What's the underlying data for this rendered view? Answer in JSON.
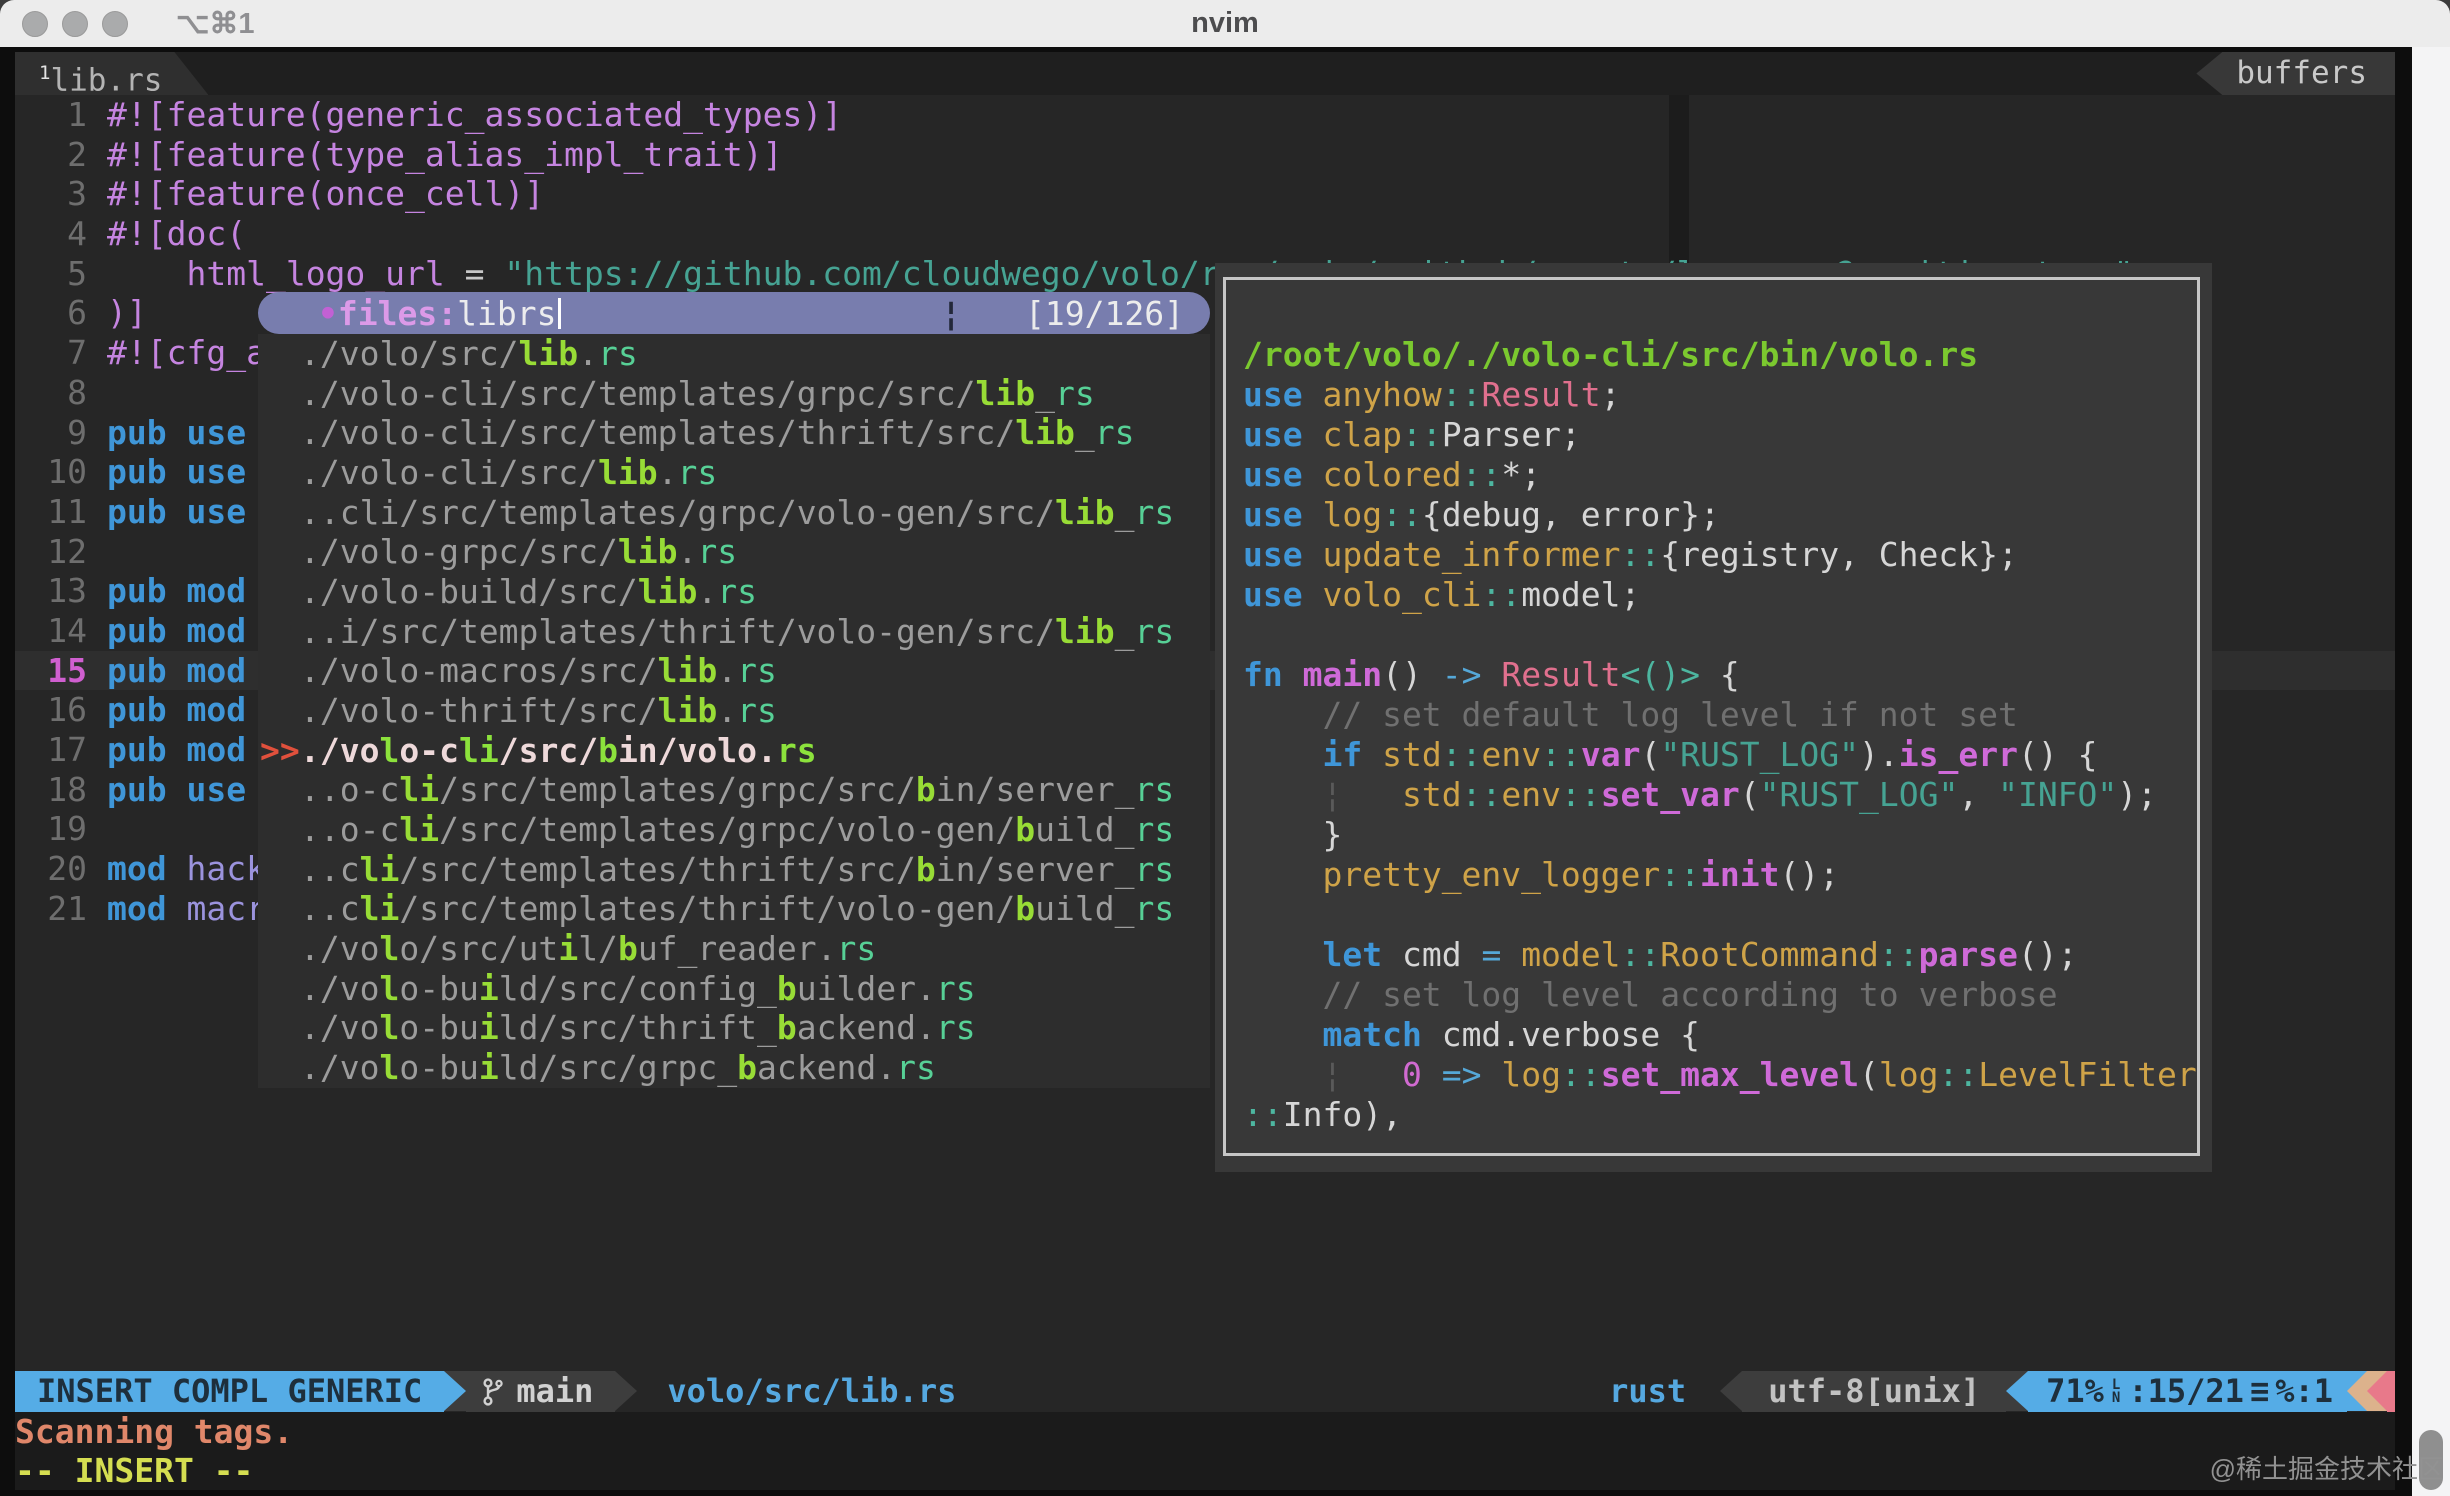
{
  "window": {
    "title": "nvim",
    "shortcut": "⌥⌘1"
  },
  "tabline": {
    "tab_index": "1",
    "tab_label": "lib.rs",
    "right_label": "buffers"
  },
  "editor": {
    "cursor_line": 15,
    "lines": [
      {
        "num": "1",
        "segs": [
          [
            "attr",
            "#![feature(generic_associated_types)]"
          ]
        ]
      },
      {
        "num": "2",
        "segs": [
          [
            "attr",
            "#![feature(type_alias_impl_trait)]"
          ]
        ]
      },
      {
        "num": "3",
        "segs": [
          [
            "attr",
            "#![feature(once_cell)]"
          ]
        ]
      },
      {
        "num": "4",
        "segs": [
          [
            "attr",
            "#![doc("
          ]
        ]
      },
      {
        "num": "5",
        "segs": [
          [
            "txt",
            "    "
          ],
          [
            "attr",
            "html_logo_url"
          ],
          [
            "txt",
            " = "
          ],
          [
            "str",
            "\"https://github.com/cloudwego/volo/raw/main/.github/assets/logo.png?sanitize=true\""
          ]
        ]
      },
      {
        "num": "6",
        "segs": [
          [
            "attr",
            ")]"
          ]
        ]
      },
      {
        "num": "7",
        "segs": [
          [
            "attr",
            "#![cfg_a"
          ]
        ]
      },
      {
        "num": "8",
        "segs": []
      },
      {
        "num": "9",
        "segs": [
          [
            "kw",
            "pub use"
          ]
        ]
      },
      {
        "num": "10",
        "segs": [
          [
            "kw",
            "pub use"
          ]
        ]
      },
      {
        "num": "11",
        "segs": [
          [
            "kw",
            "pub use"
          ]
        ]
      },
      {
        "num": "12",
        "segs": []
      },
      {
        "num": "13",
        "segs": [
          [
            "kw",
            "pub mod"
          ]
        ]
      },
      {
        "num": "14",
        "segs": [
          [
            "kw",
            "pub mod"
          ]
        ]
      },
      {
        "num": "15",
        "segs": [
          [
            "kw",
            "pub mod"
          ]
        ]
      },
      {
        "num": "16",
        "segs": [
          [
            "kw",
            "pub mod"
          ]
        ]
      },
      {
        "num": "17",
        "segs": [
          [
            "kw",
            "pub mod"
          ]
        ]
      },
      {
        "num": "18",
        "segs": [
          [
            "kw",
            "pub use"
          ]
        ]
      },
      {
        "num": "19",
        "segs": []
      },
      {
        "num": "20",
        "segs": [
          [
            "kw",
            "mod"
          ],
          [
            "txt",
            " "
          ],
          [
            "mod2",
            "hack"
          ]
        ]
      },
      {
        "num": "21",
        "segs": [
          [
            "kw",
            "mod"
          ],
          [
            "txt",
            " "
          ],
          [
            "mod2",
            "macr"
          ]
        ]
      }
    ]
  },
  "popup": {
    "bullet": "•",
    "mode_label": "files:",
    "query": "librs",
    "separator": "¦",
    "count": "[19/126]",
    "marker": ">>",
    "selected_index": 10,
    "items": [
      {
        "segs": [
          [
            "g",
            "./volo/src/"
          ],
          [
            "m",
            "lib"
          ],
          [
            "g",
            "."
          ],
          [
            "e",
            "rs"
          ]
        ]
      },
      {
        "segs": [
          [
            "g",
            "./volo-cli/src/templates/grpc/src/"
          ],
          [
            "m",
            "lib"
          ],
          [
            "g",
            "_"
          ],
          [
            "e",
            "rs"
          ]
        ]
      },
      {
        "segs": [
          [
            "g",
            "./volo-cli/src/templates/thrift/src/"
          ],
          [
            "m",
            "lib"
          ],
          [
            "g",
            "_"
          ],
          [
            "e",
            "rs"
          ]
        ]
      },
      {
        "segs": [
          [
            "g",
            "./volo-cli/src/"
          ],
          [
            "m",
            "lib"
          ],
          [
            "g",
            "."
          ],
          [
            "e",
            "rs"
          ]
        ]
      },
      {
        "segs": [
          [
            "g",
            "..cli/src/templates/grpc/volo-gen/src/"
          ],
          [
            "m",
            "lib"
          ],
          [
            "g",
            "_"
          ],
          [
            "e",
            "rs"
          ]
        ]
      },
      {
        "segs": [
          [
            "g",
            "./volo-grpc/src/"
          ],
          [
            "m",
            "lib"
          ],
          [
            "g",
            "."
          ],
          [
            "e",
            "rs"
          ]
        ]
      },
      {
        "segs": [
          [
            "g",
            "./volo-build/src/"
          ],
          [
            "m",
            "lib"
          ],
          [
            "g",
            "."
          ],
          [
            "e",
            "rs"
          ]
        ]
      },
      {
        "segs": [
          [
            "g",
            "..i/src/templates/thrift/volo-gen/src/"
          ],
          [
            "m",
            "lib"
          ],
          [
            "g",
            "_"
          ],
          [
            "e",
            "rs"
          ]
        ]
      },
      {
        "segs": [
          [
            "g",
            "./volo-macros/src/"
          ],
          [
            "m",
            "lib"
          ],
          [
            "g",
            "."
          ],
          [
            "e",
            "rs"
          ]
        ]
      },
      {
        "segs": [
          [
            "g",
            "./volo-thrift/src/"
          ],
          [
            "m",
            "lib"
          ],
          [
            "g",
            "."
          ],
          [
            "e",
            "rs"
          ]
        ]
      },
      {
        "segs": [
          [
            "sel",
            "./vo"
          ],
          [
            "selm",
            "l"
          ],
          [
            "sel",
            "o-c"
          ],
          [
            "selm",
            "li"
          ],
          [
            "sel",
            "/src/"
          ],
          [
            "selm",
            "b"
          ],
          [
            "sel",
            "in/volo."
          ],
          [
            "selm",
            "rs"
          ]
        ]
      },
      {
        "segs": [
          [
            "g",
            "..o-c"
          ],
          [
            "m",
            "li"
          ],
          [
            "g",
            "/src/templates/grpc/src/"
          ],
          [
            "m",
            "b"
          ],
          [
            "g",
            "in/server_"
          ],
          [
            "e",
            "rs"
          ]
        ]
      },
      {
        "segs": [
          [
            "g",
            "..o-c"
          ],
          [
            "m",
            "li"
          ],
          [
            "g",
            "/src/templates/grpc/volo-gen/"
          ],
          [
            "m",
            "b"
          ],
          [
            "g",
            "uild_"
          ],
          [
            "e",
            "rs"
          ]
        ]
      },
      {
        "segs": [
          [
            "g",
            "..c"
          ],
          [
            "m",
            "li"
          ],
          [
            "g",
            "/src/templates/thrift/src/"
          ],
          [
            "m",
            "b"
          ],
          [
            "g",
            "in/server_"
          ],
          [
            "e",
            "rs"
          ]
        ]
      },
      {
        "segs": [
          [
            "g",
            "..c"
          ],
          [
            "m",
            "li"
          ],
          [
            "g",
            "/src/templates/thrift/volo-gen/"
          ],
          [
            "m",
            "b"
          ],
          [
            "g",
            "uild_"
          ],
          [
            "e",
            "rs"
          ]
        ]
      },
      {
        "segs": [
          [
            "g",
            "./vo"
          ],
          [
            "m",
            "l"
          ],
          [
            "g",
            "o/src/ut"
          ],
          [
            "m",
            "i"
          ],
          [
            "g",
            "l/"
          ],
          [
            "m",
            "b"
          ],
          [
            "g",
            "uf_reader."
          ],
          [
            "e",
            "rs"
          ]
        ]
      },
      {
        "segs": [
          [
            "g",
            "./vo"
          ],
          [
            "m",
            "l"
          ],
          [
            "g",
            "o-bu"
          ],
          [
            "m",
            "i"
          ],
          [
            "g",
            "ld/src/config_"
          ],
          [
            "m",
            "b"
          ],
          [
            "g",
            "uilder."
          ],
          [
            "e",
            "rs"
          ]
        ]
      },
      {
        "segs": [
          [
            "g",
            "./vo"
          ],
          [
            "m",
            "l"
          ],
          [
            "g",
            "o-bu"
          ],
          [
            "m",
            "i"
          ],
          [
            "g",
            "ld/src/thrift_"
          ],
          [
            "m",
            "b"
          ],
          [
            "g",
            "ackend."
          ],
          [
            "e",
            "rs"
          ]
        ]
      },
      {
        "segs": [
          [
            "g",
            "./vo"
          ],
          [
            "m",
            "l"
          ],
          [
            "g",
            "o-bu"
          ],
          [
            "m",
            "i"
          ],
          [
            "g",
            "ld/src/grpc_"
          ],
          [
            "m",
            "b"
          ],
          [
            "g",
            "ackend."
          ],
          [
            "e",
            "rs"
          ]
        ]
      }
    ]
  },
  "preview": {
    "lines": [
      {
        "segs": [
          [
            "title",
            "/root/volo/./volo-cli/src/bin/volo.rs"
          ]
        ]
      },
      {
        "segs": [
          [
            "kw",
            "use"
          ],
          [
            "w",
            " "
          ],
          [
            "modn",
            "anyhow"
          ],
          [
            "punct",
            "::"
          ],
          [
            "type",
            "Result"
          ],
          [
            "w",
            ";"
          ]
        ]
      },
      {
        "segs": [
          [
            "kw",
            "use"
          ],
          [
            "w",
            " "
          ],
          [
            "modn",
            "clap"
          ],
          [
            "punct",
            "::"
          ],
          [
            "w",
            "Parser;"
          ]
        ]
      },
      {
        "segs": [
          [
            "kw",
            "use"
          ],
          [
            "w",
            " "
          ],
          [
            "modn",
            "colored"
          ],
          [
            "punct",
            "::"
          ],
          [
            "w",
            "*;"
          ]
        ]
      },
      {
        "segs": [
          [
            "kw",
            "use"
          ],
          [
            "w",
            " "
          ],
          [
            "modn",
            "log"
          ],
          [
            "punct",
            "::"
          ],
          [
            "w",
            "{debug, error};"
          ]
        ]
      },
      {
        "segs": [
          [
            "kw",
            "use"
          ],
          [
            "w",
            " "
          ],
          [
            "modn",
            "update_informer"
          ],
          [
            "punct",
            "::"
          ],
          [
            "w",
            "{registry, Check};"
          ]
        ]
      },
      {
        "segs": [
          [
            "kw",
            "use"
          ],
          [
            "w",
            " "
          ],
          [
            "modn",
            "volo_cli"
          ],
          [
            "punct",
            "::"
          ],
          [
            "w",
            "model;"
          ]
        ]
      },
      {
        "segs": []
      },
      {
        "segs": [
          [
            "kw",
            "fn"
          ],
          [
            "w",
            " "
          ],
          [
            "fn",
            "main"
          ],
          [
            "w",
            "() "
          ],
          [
            "arrow",
            "->"
          ],
          [
            "w",
            " "
          ],
          [
            "type",
            "Result"
          ],
          [
            "punct",
            "<()>"
          ],
          [
            "w",
            " {"
          ]
        ]
      },
      {
        "segs": [
          [
            "cmt",
            "    // set default log level if not set"
          ]
        ]
      },
      {
        "segs": [
          [
            "w",
            "    "
          ],
          [
            "kw",
            "if"
          ],
          [
            "w",
            " "
          ],
          [
            "modn",
            "std"
          ],
          [
            "punct",
            "::"
          ],
          [
            "modn",
            "env"
          ],
          [
            "punct",
            "::"
          ],
          [
            "fn",
            "var"
          ],
          [
            "w",
            "("
          ],
          [
            "str",
            "\"RUST_LOG\""
          ],
          [
            "w",
            ")."
          ],
          [
            "fn",
            "is_err"
          ],
          [
            "w",
            "() {"
          ]
        ]
      },
      {
        "segs": [
          [
            "w",
            "    "
          ],
          [
            "guide",
            "¦"
          ],
          [
            "w",
            "   "
          ],
          [
            "modn",
            "std"
          ],
          [
            "punct",
            "::"
          ],
          [
            "modn",
            "env"
          ],
          [
            "punct",
            "::"
          ],
          [
            "fn",
            "set_var"
          ],
          [
            "w",
            "("
          ],
          [
            "str",
            "\"RUST_LOG\""
          ],
          [
            "w",
            ", "
          ],
          [
            "str",
            "\"INFO\""
          ],
          [
            "w",
            ");"
          ]
        ]
      },
      {
        "segs": [
          [
            "w",
            "    }"
          ]
        ]
      },
      {
        "segs": [
          [
            "w",
            "    "
          ],
          [
            "modn",
            "pretty_env_logger"
          ],
          [
            "punct",
            "::"
          ],
          [
            "fn",
            "init"
          ],
          [
            "w",
            "();"
          ]
        ]
      },
      {
        "segs": []
      },
      {
        "segs": [
          [
            "w",
            "    "
          ],
          [
            "kw",
            "let"
          ],
          [
            "w",
            " cmd "
          ],
          [
            "arrow",
            "="
          ],
          [
            "w",
            " "
          ],
          [
            "modn",
            "model"
          ],
          [
            "punct",
            "::"
          ],
          [
            "modn",
            "RootCommand"
          ],
          [
            "punct",
            "::"
          ],
          [
            "fn",
            "parse"
          ],
          [
            "w",
            "();"
          ]
        ]
      },
      {
        "segs": [
          [
            "cmt",
            "    // set log level according to verbose"
          ]
        ]
      },
      {
        "segs": [
          [
            "w",
            "    "
          ],
          [
            "kw",
            "match"
          ],
          [
            "w",
            " cmd.verbose {"
          ]
        ]
      },
      {
        "segs": [
          [
            "w",
            "    "
          ],
          [
            "guide",
            "¦"
          ],
          [
            "w",
            "   "
          ],
          [
            "num",
            "0"
          ],
          [
            "w",
            " "
          ],
          [
            "arrow",
            "=>"
          ],
          [
            "w",
            " "
          ],
          [
            "modn",
            "log"
          ],
          [
            "punct",
            "::"
          ],
          [
            "fn",
            "set_max_level"
          ],
          [
            "w",
            "("
          ],
          [
            "modn",
            "log"
          ],
          [
            "punct",
            "::"
          ],
          [
            "modn",
            "LevelFilter"
          ]
        ]
      },
      {
        "segs": [
          [
            "punct",
            "::"
          ],
          [
            "w",
            "Info),"
          ]
        ]
      }
    ]
  },
  "statusline": {
    "mode": "INSERT COMPL GENERIC",
    "branch": "main",
    "file": "volo/src/lib.rs",
    "filetype": "rust",
    "encoding": "utf-8[unix]",
    "percent": "71%",
    "ln_top": "L",
    "ln_bottom": "N",
    "position": ":15/21",
    "list_icon": "≡",
    "buffer": "%:1"
  },
  "messages": {
    "line1": "Scanning tags.",
    "line2": "-- INSERT --"
  },
  "watermark": "@稀土掘金技术社区",
  "colors": {
    "accent_blue": "#55ace6",
    "match_green": "#98dc36",
    "marker_red": "#e0503c",
    "pill_bg": "#787dae",
    "preview_bg": "#383838",
    "editor_bg": "#262626",
    "statusline_tan": "#dcb28c",
    "statusline_pink": "#e8798a"
  }
}
